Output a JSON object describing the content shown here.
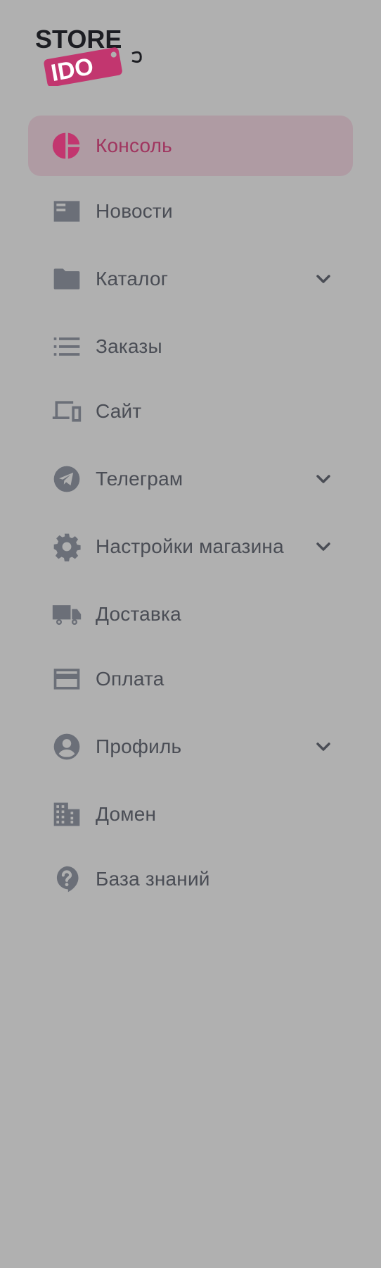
{
  "brand": {
    "line1": "STORE",
    "line2": "IDO",
    "accent_color": "#c2366f"
  },
  "colors": {
    "background": "#b0b0b0",
    "active_bg": "#af9ba3",
    "active_text": "#a0355f",
    "text": "#4a4d55",
    "icon": "#6b6f78"
  },
  "nav": {
    "items": [
      {
        "label": "Консоль",
        "icon": "pie-chart-icon",
        "active": true,
        "expandable": false
      },
      {
        "label": "Новости",
        "icon": "newspaper-icon",
        "active": false,
        "expandable": false
      },
      {
        "label": "Каталог",
        "icon": "folder-icon",
        "active": false,
        "expandable": true
      },
      {
        "label": "Заказы",
        "icon": "list-icon",
        "active": false,
        "expandable": false
      },
      {
        "label": "Сайт",
        "icon": "devices-icon",
        "active": false,
        "expandable": false
      },
      {
        "label": "Телеграм",
        "icon": "telegram-icon",
        "active": false,
        "expandable": true
      },
      {
        "label": "Настройки магазина",
        "icon": "gear-icon",
        "active": false,
        "expandable": true
      },
      {
        "label": "Доставка",
        "icon": "truck-icon",
        "active": false,
        "expandable": false
      },
      {
        "label": "Оплата",
        "icon": "credit-card-icon",
        "active": false,
        "expandable": false
      },
      {
        "label": "Профиль",
        "icon": "user-circle-icon",
        "active": false,
        "expandable": true
      },
      {
        "label": "Домен",
        "icon": "building-icon",
        "active": false,
        "expandable": false
      },
      {
        "label": "База знаний",
        "icon": "help-bubble-icon",
        "active": false,
        "expandable": false
      }
    ]
  }
}
